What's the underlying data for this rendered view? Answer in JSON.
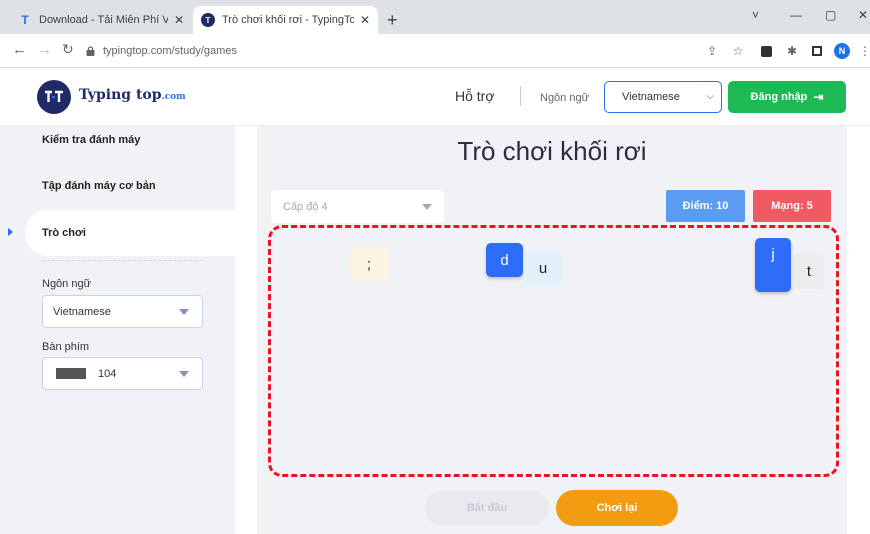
{
  "browser": {
    "tabs": [
      {
        "title": "Download - Tải Miễn Phí VN - Pl",
        "favicon": "T"
      },
      {
        "title": "Trò chơi khối rơi - TypingTop",
        "favicon": "T"
      }
    ],
    "new_tab": "+",
    "window_controls": {
      "collapse": "˅",
      "minimize": "—",
      "maximize": "▢",
      "close": "✕"
    },
    "url": "typingtop.com/study/games",
    "profile_initial": "N"
  },
  "header": {
    "logo_text": "Typing top",
    "logo_domain": ".com",
    "logo_mark": "T-T",
    "support": "Hỗ trợ",
    "language_label": "Ngôn ngữ",
    "language_value": "Vietnamese",
    "login": "Đăng nhập"
  },
  "sidebar": {
    "items": [
      {
        "label": "Kiểm tra đánh máy"
      },
      {
        "label": "Tập đánh máy cơ bản"
      },
      {
        "label": "Trò chơi"
      }
    ],
    "language_label": "Ngôn ngữ",
    "language_value": "Vietnamese",
    "keyboard_label": "Bàn phím",
    "keyboard_value": "104"
  },
  "main": {
    "title": "Trò chơi khối rơi",
    "level": "Cấp độ 4",
    "score": "Điểm: 10",
    "lives": "Mạng: 5",
    "blocks": [
      {
        "char": ";",
        "color": "#fdf5e1"
      },
      {
        "char": "d",
        "color": "#2c6cf6"
      },
      {
        "char": "u",
        "color": "#e3f1fb"
      },
      {
        "char": "j",
        "color": "#2c6cf6"
      },
      {
        "char": "t",
        "color": "#ececec"
      }
    ],
    "start_button": "Bắt đầu",
    "replay_button": "Chơi lại"
  },
  "colors": {
    "accent_blue": "#2c6cf6",
    "login_green": "#1db954",
    "score_blue": "#5b9cf2",
    "lives_red": "#f05a62",
    "replay_orange": "#f39c12",
    "game_border": "#e8141f"
  }
}
